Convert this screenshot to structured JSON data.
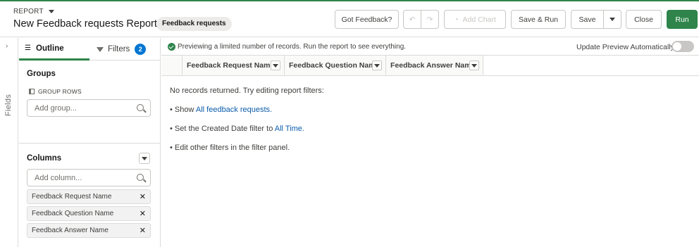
{
  "header": {
    "report_label": "REPORT",
    "title": "New Feedback requests Report",
    "report_type": "Feedback requests",
    "buttons": {
      "got_feedback": "Got Feedback?",
      "add_chart": "Add Chart",
      "save_run": "Save & Run",
      "save": "Save",
      "close": "Close",
      "run": "Run"
    }
  },
  "sidebar": {
    "fields_label": "Fields"
  },
  "left_panel": {
    "tabs": {
      "outline": "Outline",
      "filters": "Filters",
      "filters_count": "2"
    },
    "groups": {
      "title": "Groups",
      "group_rows_label": "GROUP ROWS",
      "add_group_placeholder": "Add group..."
    },
    "columns": {
      "title": "Columns",
      "add_column_placeholder": "Add column...",
      "items": [
        "Feedback Request Name",
        "Feedback Question Name",
        "Feedback Answer Name"
      ]
    }
  },
  "main": {
    "preview_text": "Previewing a limited number of records. Run the report to see everything.",
    "update_preview_label": "Update Preview Automatically",
    "table_headers": [
      "Feedback Request Name",
      "Feedback Question Name",
      "Feedback Answer Name"
    ],
    "empty": {
      "line1": "No records returned. Try editing report filters:",
      "show_prefix": "• Show ",
      "show_link": "All feedback requests.",
      "date_prefix": "• Set the Created Date filter to ",
      "date_link": "All Time.",
      "edit_filters": "• Edit other filters in the filter panel."
    }
  },
  "colors": {
    "accent": "#2e844a",
    "link": "#0b5cab",
    "badge": "#0176d3"
  }
}
